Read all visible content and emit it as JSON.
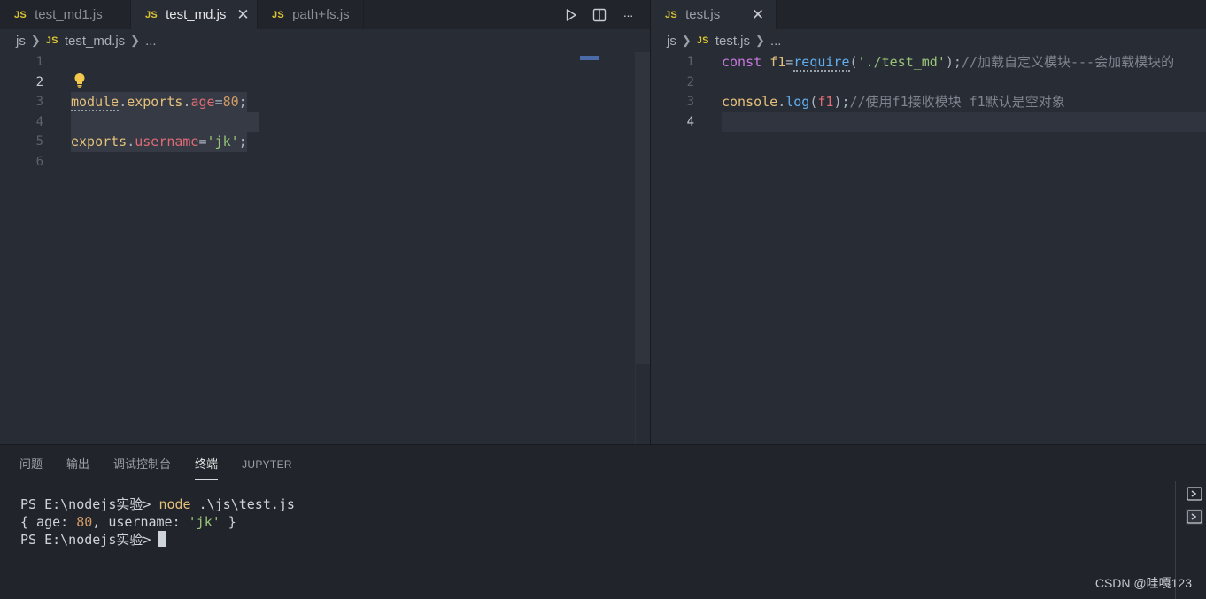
{
  "left_tabs": [
    {
      "badge": "JS",
      "label": "test_md1.js",
      "active": false
    },
    {
      "badge": "JS",
      "label": "test_md.js",
      "active": true,
      "close": "✕"
    },
    {
      "badge": "JS",
      "label": "path+fs.js",
      "active": false
    }
  ],
  "left_actions": {
    "run": "run-icon",
    "split": "split-editor-icon",
    "more": "···"
  },
  "right_tabs": [
    {
      "badge": "JS",
      "label": "test.js",
      "active": true,
      "close": "✕"
    }
  ],
  "left_breadcrumb": {
    "folder": "js",
    "badge": "JS",
    "file": "test_md.js",
    "ellipsis": "..."
  },
  "right_breadcrumb": {
    "folder": "js",
    "badge": "JS",
    "file": "test.js",
    "ellipsis": "..."
  },
  "left_editor": {
    "line_numbers": [
      "1",
      "2",
      "3",
      "4",
      "5",
      "6"
    ],
    "current_line": "2",
    "line3": {
      "obj": "module",
      "dot1": ".",
      "prop": "exports",
      "dot2": ".",
      "key": "age",
      "eq": "=",
      "num": "80",
      "end": ";"
    },
    "line5": {
      "obj": "exports",
      "dot": ".",
      "key": "username",
      "eq": "=",
      "str": "'jk'",
      "end": ";"
    }
  },
  "right_editor": {
    "line_numbers": [
      "1",
      "2",
      "3",
      "4"
    ],
    "current_line": "4",
    "line1": {
      "kw": "const",
      "space": " ",
      "var": "f1",
      "eq": "=",
      "fn": "require",
      "open": "(",
      "str": "'./test_md'",
      "close": ");",
      "comment": "//加载自定义模块---会加载模块的"
    },
    "line3": {
      "obj": "console",
      "dot": ".",
      "fn": "log",
      "open": "(",
      "param": "f1",
      "close": ");",
      "comment": "//使用f1接收模块 f1默认是空对象"
    }
  },
  "panel": {
    "tabs": [
      "问题",
      "输出",
      "调试控制台",
      "终端",
      "JUPYTER"
    ],
    "active_tab": "终端",
    "terminal": {
      "prompt1": "PS E:\\nodejs实验> ",
      "cmd": "node",
      "args": " .\\js\\test.js",
      "out_open": "{ age: ",
      "out_num": "80",
      "out_mid": ", username: ",
      "out_str": "'jk'",
      "out_close": " }",
      "prompt2": "PS E:\\nodejs实验> "
    }
  },
  "watermark": "CSDN @哇嘎123",
  "colors": {
    "editor_bg": "#282c34",
    "chrome_bg": "#21252b",
    "js_badge": "#dcc433",
    "accent": "#61afef"
  }
}
